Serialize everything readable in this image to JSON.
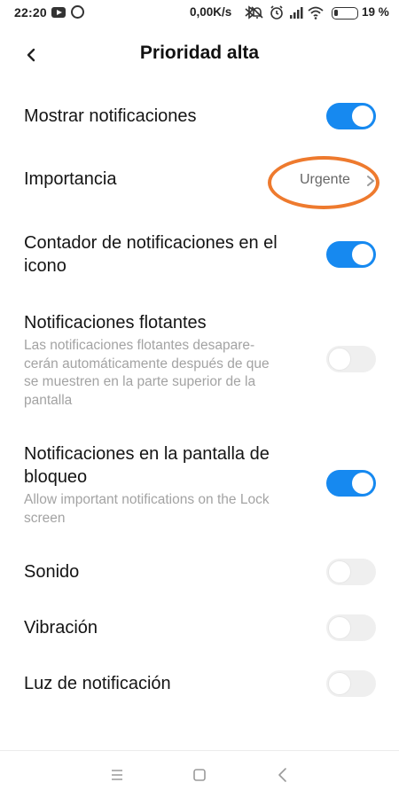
{
  "status_bar": {
    "time": "22:20",
    "network_speed": "0,00K/s",
    "battery_percent": "19 %",
    "battery_level": 0.19,
    "icons": [
      "youtube-icon",
      "whatsapp-icon",
      "bluetooth-icon",
      "bell-off-icon",
      "alarm-icon",
      "signal-icon",
      "wifi-icon",
      "battery-icon"
    ]
  },
  "header": {
    "title": "Prioridad alta",
    "back_icon": "chevron-left-icon"
  },
  "settings": {
    "show_notifications": {
      "label": "Mostrar notificaciones",
      "enabled": true
    },
    "importance": {
      "label": "Importancia",
      "value": "Urgente"
    },
    "badge_counter": {
      "label_line1": "Contador de notificaciones en el",
      "label_line2": "icono",
      "enabled": true
    },
    "floating": {
      "label": "Notificaciones flotantes",
      "desc_line1": "Las notificaciones flotantes desapare-",
      "desc_line2": "cerán automáticamente después de que",
      "desc_line3": "se muestren en la parte superior de la",
      "desc_line4": "pantalla",
      "enabled": false
    },
    "lock_screen": {
      "label_line1": "Notificaciones en la pantalla de",
      "label_line2": "bloqueo",
      "desc_line1": "Allow important notifications on the Lock",
      "desc_line2": "screen",
      "enabled": true
    },
    "sound": {
      "label": "Sonido",
      "enabled": false
    },
    "vibration": {
      "label": "Vibración",
      "enabled": false
    },
    "light": {
      "label": "Luz de notificación",
      "enabled": false
    }
  },
  "colors": {
    "accent": "#1689f0",
    "toggle_off": "#efefef",
    "highlight": "#ee7a2e",
    "secondary_text": "#a3a3a3"
  },
  "nav_bar": {
    "icons": [
      "menu-icon",
      "home-square-icon",
      "back-triangle-icon"
    ]
  }
}
